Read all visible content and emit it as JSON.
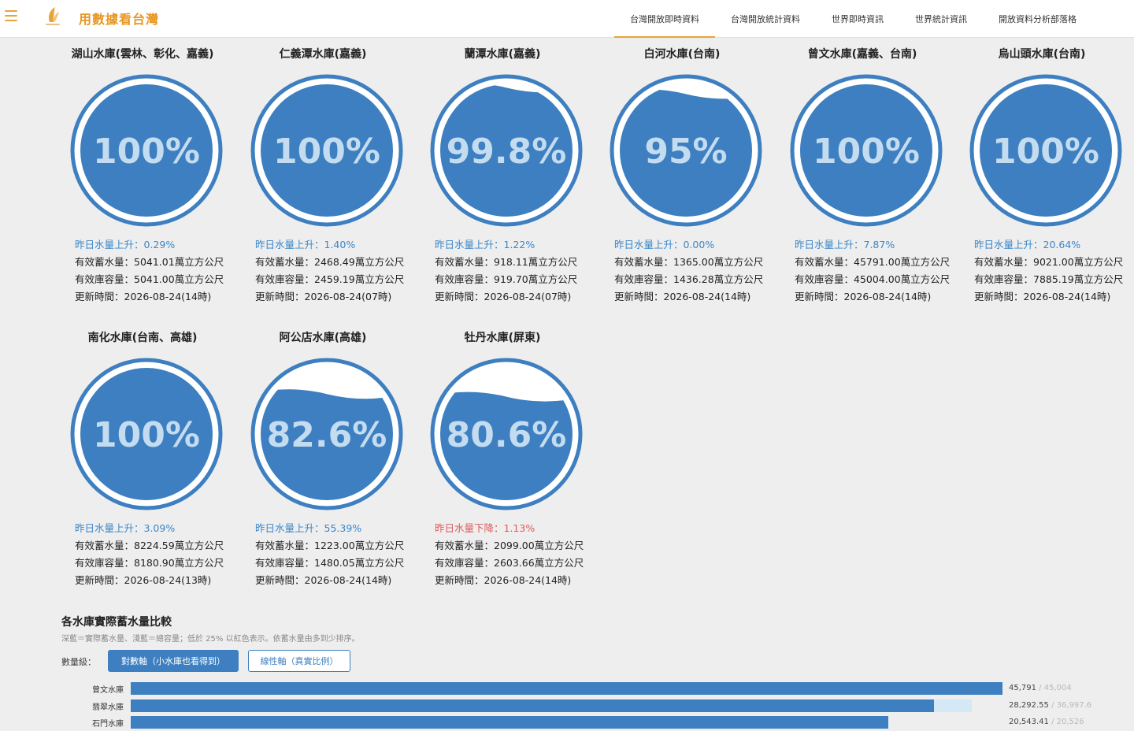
{
  "header": {
    "title": "用數據看台灣",
    "nav": [
      {
        "label": "台灣開放即時資料",
        "active": true
      },
      {
        "label": "台灣開放統計資料",
        "active": false
      },
      {
        "label": "世界即時資訊",
        "active": false
      },
      {
        "label": "世界統計資訊",
        "active": false
      },
      {
        "label": "開放資料分析部落格",
        "active": false
      }
    ]
  },
  "colors": {
    "accent": "#e8a33b",
    "water": "#3d7fc0",
    "rise": "#3a86c8",
    "fall": "#e05a5a"
  },
  "reservoirs": [
    {
      "name": "湖山水庫(雲林、彰化、嘉義)",
      "percent": "100%",
      "fill": 1.0,
      "change": "昨日水量上升：0.29%",
      "direction": "up",
      "storage": "有效蓄水量：5041.01萬立方公尺",
      "capacity": "有效庫容量：5041.00萬立方公尺",
      "updated": "更新時間：2026-08-24(14時)"
    },
    {
      "name": "仁義潭水庫(嘉義)",
      "percent": "100%",
      "fill": 1.0,
      "change": "昨日水量上升：1.40%",
      "direction": "up",
      "storage": "有效蓄水量：2468.49萬立方公尺",
      "capacity": "有效庫容量：2459.19萬立方公尺",
      "updated": "更新時間：2026-08-24(07時)"
    },
    {
      "name": "蘭潭水庫(嘉義)",
      "percent": "99.8%",
      "fill": 0.998,
      "change": "昨日水量上升：1.22%",
      "direction": "up",
      "storage": "有效蓄水量：918.11萬立方公尺",
      "capacity": "有效庫容量：919.70萬立方公尺",
      "updated": "更新時間：2026-08-24(07時)"
    },
    {
      "name": "白河水庫(台南)",
      "percent": "95%",
      "fill": 0.95,
      "change": "昨日水量上升：0.00%",
      "direction": "up",
      "storage": "有效蓄水量：1365.00萬立方公尺",
      "capacity": "有效庫容量：1436.28萬立方公尺",
      "updated": "更新時間：2026-08-24(14時)"
    },
    {
      "name": "曾文水庫(嘉義、台南)",
      "percent": "100%",
      "fill": 1.0,
      "change": "昨日水量上升：7.87%",
      "direction": "up",
      "storage": "有效蓄水量：45791.00萬立方公尺",
      "capacity": "有效庫容量：45004.00萬立方公尺",
      "updated": "更新時間：2026-08-24(14時)"
    },
    {
      "name": "烏山頭水庫(台南)",
      "percent": "100%",
      "fill": 1.0,
      "change": "昨日水量上升：20.64%",
      "direction": "up",
      "storage": "有效蓄水量：9021.00萬立方公尺",
      "capacity": "有效庫容量：7885.19萬立方公尺",
      "updated": "更新時間：2026-08-24(14時)"
    },
    {
      "name": "南化水庫(台南、高雄)",
      "percent": "100%",
      "fill": 1.0,
      "change": "昨日水量上升：3.09%",
      "direction": "up",
      "storage": "有效蓄水量：8224.59萬立方公尺",
      "capacity": "有效庫容量：8180.90萬立方公尺",
      "updated": "更新時間：2026-08-24(13時)"
    },
    {
      "name": "阿公店水庫(高雄)",
      "percent": "82.6%",
      "fill": 0.826,
      "change": "昨日水量上升：55.39%",
      "direction": "up",
      "storage": "有效蓄水量：1223.00萬立方公尺",
      "capacity": "有效庫容量：1480.05萬立方公尺",
      "updated": "更新時間：2026-08-24(14時)"
    },
    {
      "name": "牡丹水庫(屏東)",
      "percent": "80.6%",
      "fill": 0.806,
      "change": "昨日水量下降：1.13%",
      "direction": "down",
      "storage": "有效蓄水量：2099.00萬立方公尺",
      "capacity": "有效庫容量：2603.66萬立方公尺",
      "updated": "更新時間：2026-08-24(14時)"
    }
  ],
  "comparison": {
    "title": "各水庫實際蓄水量比較",
    "subtitle": "深藍＝實際蓄水量、淺藍＝總容量；低於 25% 以紅色表示。依蓄水量由多到少排序。",
    "scale_label": "數量級：",
    "log_button": "對數軸（小水庫也看得到）",
    "linear_button": "線性軸（真實比例）",
    "bars": [
      {
        "name": "曾文水庫",
        "current": 45791,
        "capacity": 45004,
        "current_label": "45,791",
        "capacity_label": "45,004"
      },
      {
        "name": "翡翠水庫",
        "current": 28292.55,
        "capacity": 36997.6,
        "current_label": "28,292.55",
        "capacity_label": "36,997.6"
      },
      {
        "name": "石門水庫",
        "current": 20543.41,
        "capacity": 20526,
        "current_label": "20,543.41",
        "capacity_label": "20,526"
      }
    ]
  }
}
